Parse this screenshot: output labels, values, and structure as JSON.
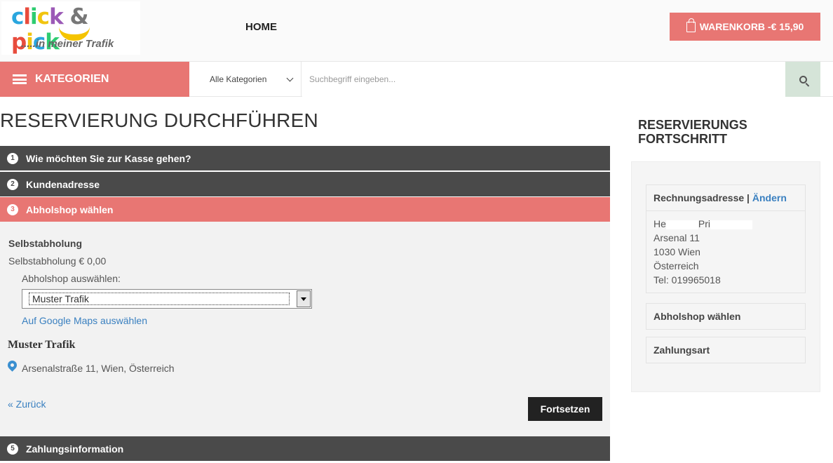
{
  "header": {
    "logo_text": "click & pick",
    "logo_sub": ".....in meiner Trafik",
    "nav_home": "HOME",
    "cart_label": "WARENKORB -€ 15,90"
  },
  "searchbar": {
    "categories_label": "KATEGORIEN",
    "category_select": "Alle Kategorien",
    "search_placeholder": "Suchbegriff eingeben..."
  },
  "main": {
    "title": "RESERVIERUNG DURCHFÜHREN",
    "steps": [
      {
        "num": "1",
        "label": "Wie möchten Sie zur Kasse gehen?"
      },
      {
        "num": "2",
        "label": "Kundenadresse"
      },
      {
        "num": "3",
        "label": "Abholshop wählen"
      },
      {
        "num": "5",
        "label": "Zahlungsinformation"
      }
    ],
    "pickup_title": "Selbstabholung",
    "pickup_price": "Selbstabholung € 0,00",
    "choose_label": "Abholshop auswählen:",
    "shop_selected": "Muster Trafik",
    "maps_link": "Auf Google Maps auswählen",
    "shop_name": "Muster Trafik",
    "shop_address": "Arsenalstraße 11,  Wien,  Österreich",
    "back_link": "« Zurück",
    "continue_button": "Fortsetzen"
  },
  "sidebar": {
    "title": "RESERVIERUNGS FORTSCHRITT",
    "billing_head": "Rechnungsadresse",
    "separator": " | ",
    "edit_link": "Ändern",
    "name_part1": "He",
    "name_part2": "Pri",
    "street": "Arsenal 11",
    "city": "1030 Wien",
    "country": "Österreich",
    "phone": "Tel: 019965018",
    "pickup_card": "Abholshop wählen",
    "payment_card": "Zahlungsart"
  },
  "colors": {
    "accent": "#e87673",
    "dark_step": "#4a4a4a",
    "link": "#3a80c0",
    "search_btn": "#d5e4d8"
  }
}
